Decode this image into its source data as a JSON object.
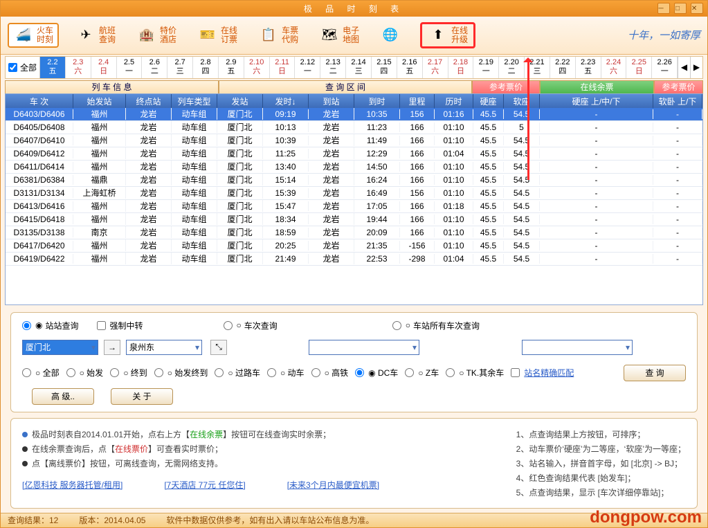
{
  "title": "极 品 时 刻 表",
  "toolbar": [
    {
      "l1": "火车",
      "l2": "时刻",
      "ico": "🚄",
      "active": true
    },
    {
      "l1": "航班",
      "l2": "查询",
      "ico": "✈"
    },
    {
      "l1": "特价",
      "l2": "酒店",
      "ico": "🏨"
    },
    {
      "l1": "在线",
      "l2": "订票",
      "ico": "🎫"
    },
    {
      "l1": "车票",
      "l2": "代购",
      "ico": "📋"
    },
    {
      "l1": "电子",
      "l2": "地图",
      "ico": "🗺"
    },
    {
      "l1": "",
      "l2": "",
      "ico": "🌐"
    },
    {
      "l1": "在线",
      "l2": "升级",
      "ico": "⬆",
      "highlight": true
    }
  ],
  "slogan": "十年，一如寄厚",
  "all_label": "全部",
  "dates": [
    {
      "d": "2.2",
      "w": "五",
      "sel": true
    },
    {
      "d": "2.3",
      "w": "六",
      "wk": true
    },
    {
      "d": "2.4",
      "w": "日",
      "wk": true
    },
    {
      "d": "2.5",
      "w": "一"
    },
    {
      "d": "2.6",
      "w": "二"
    },
    {
      "d": "2.7",
      "w": "三"
    },
    {
      "d": "2.8",
      "w": "四"
    },
    {
      "d": "2.9",
      "w": "五"
    },
    {
      "d": "2.10",
      "w": "六",
      "wk": true
    },
    {
      "d": "2.11",
      "w": "日",
      "wk": true
    },
    {
      "d": "2.12",
      "w": "一"
    },
    {
      "d": "2.13",
      "w": "二"
    },
    {
      "d": "2.14",
      "w": "三"
    },
    {
      "d": "2.15",
      "w": "四"
    },
    {
      "d": "2.16",
      "w": "五"
    },
    {
      "d": "2.17",
      "w": "六",
      "wk": true
    },
    {
      "d": "2.18",
      "w": "日",
      "wk": true
    },
    {
      "d": "2.19",
      "w": "一"
    },
    {
      "d": "2.20",
      "w": "二"
    },
    {
      "d": "2.21",
      "w": "三"
    },
    {
      "d": "2.22",
      "w": "四"
    },
    {
      "d": "2.23",
      "w": "五"
    },
    {
      "d": "2.24",
      "w": "六",
      "wk": true
    },
    {
      "d": "2.25",
      "w": "日",
      "wk": true
    },
    {
      "d": "2.26",
      "w": "一"
    }
  ],
  "seg_labels": {
    "s1": "列 车 信 息",
    "s2": "查 询 区 间",
    "s3": "参考票价",
    "s4": "在线余票",
    "s5": "参考票价"
  },
  "headers": [
    "车 次",
    "始发站",
    "终点站",
    "列车类型",
    "发站",
    "发时↓",
    "到站",
    "到时",
    "里程",
    "历时",
    "硬座",
    "软座",
    "硬座 上/中/下",
    "软卧 上/下"
  ],
  "rows": [
    {
      "d": [
        "D6403/D6406",
        "福州",
        "龙岩",
        "动车组",
        "厦门北",
        "09:19",
        "龙岩",
        "10:35",
        "156",
        "01:16",
        "45.5",
        "54.5",
        "-",
        "-"
      ],
      "sel": true
    },
    {
      "d": [
        "D6405/D6408",
        "福州",
        "龙岩",
        "动车组",
        "厦门北",
        "10:13",
        "龙岩",
        "11:23",
        "166",
        "01:10",
        "45.5",
        "5",
        "-",
        "-"
      ]
    },
    {
      "d": [
        "D6407/D6410",
        "福州",
        "龙岩",
        "动车组",
        "厦门北",
        "10:39",
        "龙岩",
        "11:49",
        "166",
        "01:10",
        "45.5",
        "54.5",
        "-",
        "-"
      ]
    },
    {
      "d": [
        "D6409/D6412",
        "福州",
        "龙岩",
        "动车组",
        "厦门北",
        "11:25",
        "龙岩",
        "12:29",
        "166",
        "01:04",
        "45.5",
        "54.5",
        "-",
        "-"
      ]
    },
    {
      "d": [
        "D6411/D6414",
        "福州",
        "龙岩",
        "动车组",
        "厦门北",
        "13:40",
        "龙岩",
        "14:50",
        "166",
        "01:10",
        "45.5",
        "54.5",
        "-",
        "-"
      ]
    },
    {
      "d": [
        "D6381/D6384",
        "福鼎",
        "龙岩",
        "动车组",
        "厦门北",
        "15:14",
        "龙岩",
        "16:24",
        "166",
        "01:10",
        "45.5",
        "54.5",
        "-",
        "-"
      ]
    },
    {
      "d": [
        "D3131/D3134",
        "上海虹桥",
        "龙岩",
        "动车组",
        "厦门北",
        "15:39",
        "龙岩",
        "16:49",
        "156",
        "01:10",
        "45.5",
        "54.5",
        "-",
        "-"
      ]
    },
    {
      "d": [
        "D6413/D6416",
        "福州",
        "龙岩",
        "动车组",
        "厦门北",
        "15:47",
        "龙岩",
        "17:05",
        "166",
        "01:18",
        "45.5",
        "54.5",
        "-",
        "-"
      ]
    },
    {
      "d": [
        "D6415/D6418",
        "福州",
        "龙岩",
        "动车组",
        "厦门北",
        "18:34",
        "龙岩",
        "19:44",
        "166",
        "01:10",
        "45.5",
        "54.5",
        "-",
        "-"
      ]
    },
    {
      "d": [
        "D3135/D3138",
        "南京",
        "龙岩",
        "动车组",
        "厦门北",
        "18:59",
        "龙岩",
        "20:09",
        "166",
        "01:10",
        "45.5",
        "54.5",
        "-",
        "-"
      ]
    },
    {
      "d": [
        "D6417/D6420",
        "福州",
        "龙岩",
        "动车组",
        "厦门北",
        "20:25",
        "龙岩",
        "21:35",
        "-156",
        "01:10",
        "45.5",
        "54.5",
        "-",
        "-"
      ]
    },
    {
      "d": [
        "D6419/D6422",
        "福州",
        "龙岩",
        "动车组",
        "厦门北",
        "21:49",
        "龙岩",
        "22:53",
        "-298",
        "01:04",
        "45.5",
        "54.5",
        "-",
        "-"
      ]
    }
  ],
  "query": {
    "station_q": "站站查询",
    "force": "强制中转",
    "train_q": "车次查询",
    "station_all_q": "车站所有车次查询",
    "from": "厦门北",
    "to": "泉州东",
    "filters": [
      "全部",
      "始发",
      "终到",
      "始发终到",
      "过路车",
      "动车",
      "高铁",
      "DC车",
      "Z车",
      "TK.其余车"
    ],
    "exact": "站名精确匹配",
    "btn_query": "查 询",
    "btn_adv": "高 级..",
    "btn_about": "关 于"
  },
  "tips_left": [
    "极品时刻表自2014.01.01开始，点右上方【在线余票】按钮可在线查询实时余票；",
    "在线余票查询后，点【在线票价】可查看实时票价；",
    "点【离线票价】按钮，可离线查询，无需网络支持。"
  ],
  "tips_right": [
    "1、点查询结果上方按钮，可排序；",
    "2、动车票价‘硬座’为二等座，‘软座’为一等座；",
    "3、站名输入，拼音首字母，如 [北京] -> BJ；",
    "4、红色查询结果代表 [始发车]；",
    "5、点查询结果，显示 [车次详细停靠站]；"
  ],
  "links": [
    "[亿恩科技 服务器托管/租用]",
    "[7天酒店 77元 任您住]",
    "[未来3个月内最便宜机票]"
  ],
  "status": {
    "l": "查询结果：12",
    "m": "版本：2014.04.05",
    "r": "软件中数据仅供参考，如有出入请以车站公布信息为准。"
  },
  "watermark": "dongpow.com"
}
